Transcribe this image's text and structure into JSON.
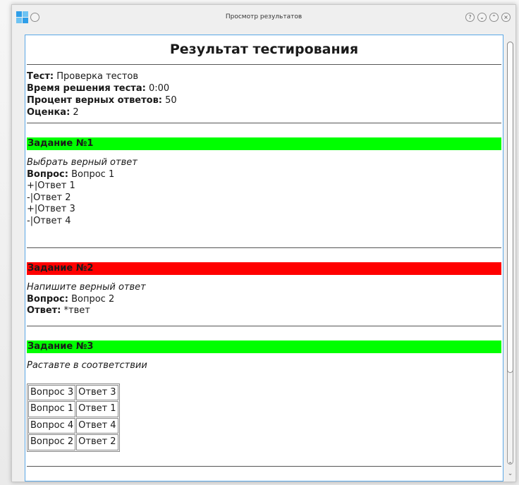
{
  "window": {
    "title": "Просмотр результатов"
  },
  "report": {
    "title": "Результат тестирования",
    "meta": [
      {
        "label": "Тест:",
        "value": "Проверка тестов"
      },
      {
        "label": "Время решения теста:",
        "value": "0:00"
      },
      {
        "label": "Процент верных ответов:",
        "value": "50"
      },
      {
        "label": "Оценка:",
        "value": "2"
      }
    ],
    "tasks": [
      {
        "heading": "Задание №1",
        "status_color": "#00ff00",
        "instruction": "Выбрать верный ответ",
        "question_label": "Вопрос:",
        "question": "Вопрос 1",
        "options": [
          "+|Ответ 1",
          "-|Ответ 2",
          "+|Ответ 3",
          "-|Ответ 4"
        ]
      },
      {
        "heading": "Задание №2",
        "status_color": "#ff0000",
        "instruction": "Напишите верный ответ",
        "question_label": "Вопрос:",
        "question": "Вопрос 2",
        "answer_label": "Ответ:",
        "answer": "*твет"
      },
      {
        "heading": "Задание №3",
        "status_color": "#00ff00",
        "instruction": "Раставте в соответствии",
        "pairs": [
          [
            "Вопрос 3",
            "Ответ 3"
          ],
          [
            "Вопрос 1",
            "Ответ 1"
          ],
          [
            "Вопрос 4",
            "Ответ 4"
          ],
          [
            "Вопрос 2",
            "Ответ 2"
          ]
        ]
      }
    ]
  },
  "icons": {
    "app": "app-icon",
    "help": "help-icon",
    "minimize": "minimize-icon",
    "maximize": "maximize-icon",
    "close": "close-icon"
  }
}
